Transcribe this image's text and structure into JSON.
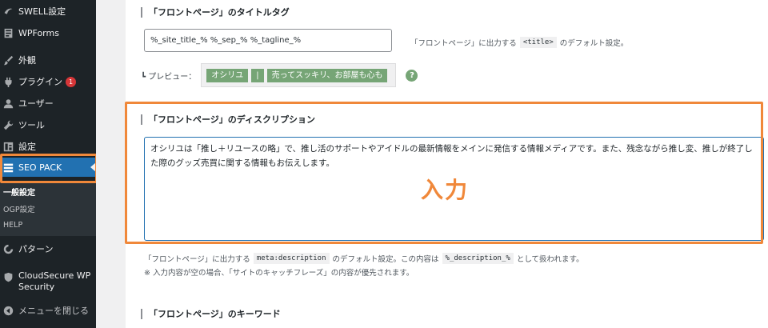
{
  "sidebar": {
    "items": [
      {
        "label": "SWELL設定",
        "icon": "swell-icon"
      },
      {
        "label": "WPForms",
        "icon": "forms-icon"
      },
      {
        "label": "外観",
        "icon": "brush-icon"
      },
      {
        "label": "プラグイン",
        "icon": "plugin-icon",
        "badge": "1"
      },
      {
        "label": "ユーザー",
        "icon": "user-icon"
      },
      {
        "label": "ツール",
        "icon": "wrench-icon"
      },
      {
        "label": "設定",
        "icon": "settings-icon"
      },
      {
        "label": "SEO PACK",
        "icon": "list-icon",
        "active": true
      }
    ],
    "submenu": [
      "一般設定",
      "OGP設定",
      "HELP"
    ],
    "pattern_label": "パターン",
    "cloudsecure_label_line1": "CloudSecure WP",
    "cloudsecure_label_line2": "Security",
    "collapse_label": "メニューを閉じる"
  },
  "title_tag": {
    "heading": "「フロントページ」のタイトルタグ",
    "value": "%_site_title_% %_sep_% %_tagline_%",
    "hint_before": "「フロントページ」に出力する",
    "hint_code": "<title>",
    "hint_after": "のデフォルト設定。",
    "preview_label": "┗ プレビュー：",
    "preview_chips": [
      "オシリユ",
      "|",
      "売ってスッキリ、お部屋も心も"
    ],
    "help": "?"
  },
  "description": {
    "heading": "「フロントページ」のディスクリプション",
    "value": "オシリユは「推し＋リユースの略」で、推し活のサポートやアイドルの最新情報をメインに発信する情報メディアです。また、残念ながら推し変、推しが終了した際のグッズ売買に関する情報もお伝えします。",
    "annotation": "入力",
    "hint_before": "「フロントページ」に出力する",
    "hint_code": "meta:description",
    "hint_mid": "のデフォルト設定。この内容は",
    "hint_code2": "%_description_%",
    "hint_after": "として扱われます。",
    "note": "※ 入力内容が空の場合、「サイトのキャッチフレーズ」の内容が優先されます。"
  },
  "keywords": {
    "heading": "「フロントページ」のキーワード"
  },
  "colors": {
    "sidebar_bg": "#1d2327",
    "active": "#2271b1",
    "highlight": "#f0883a",
    "chip": "#76a576"
  }
}
